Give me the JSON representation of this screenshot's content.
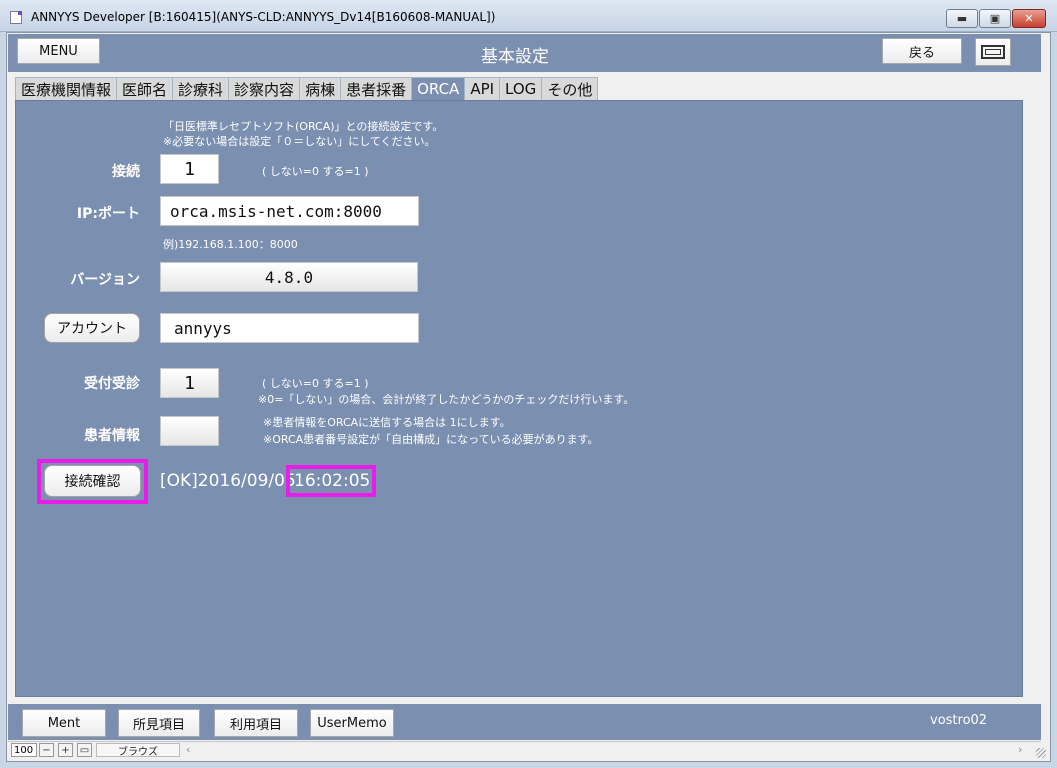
{
  "window": {
    "title": "ANNYYS Developer [B:160415](ANYS-CLD:ANNYYS_Dv14[B160608-MANUAL])",
    "controls": {
      "minimize": "▬",
      "maximize": "▣",
      "close": "✕"
    }
  },
  "header": {
    "menu_label": "MENU",
    "title": "基本設定",
    "back_label": "戻る"
  },
  "tabs": [
    {
      "label": "医療機関情報",
      "active": false
    },
    {
      "label": "医師名",
      "active": false
    },
    {
      "label": "診療科",
      "active": false
    },
    {
      "label": "診察内容",
      "active": false
    },
    {
      "label": "病棟",
      "active": false
    },
    {
      "label": "患者採番",
      "active": false
    },
    {
      "label": "ORCA",
      "active": true
    },
    {
      "label": "API",
      "active": false
    },
    {
      "label": "LOG",
      "active": false
    },
    {
      "label": "その他",
      "active": false
    }
  ],
  "orca": {
    "intro_line1": "「日医標準レセプトソフト(ORCA)」との接続設定です。",
    "intro_line2": "※必要ない場合は設定「０＝しない」にしてください。",
    "connect": {
      "label": "接続",
      "value": "1",
      "hint": "( しない=0 する=1 )"
    },
    "ip_port": {
      "label": "IP:ポート",
      "value": "orca.msis-net.com:8000",
      "example": "例)192.168.1.100：8000"
    },
    "version": {
      "label": "バージョン",
      "value": "4.8.0"
    },
    "account": {
      "button_label": "アカウント",
      "value": "annyys"
    },
    "reception": {
      "label": "受付受診",
      "value": "1",
      "hint": "( しない=0 する=1 )",
      "note": "※0=「しない」の場合、会計が終了したかどうかのチェックだけ行います。"
    },
    "patient_info": {
      "label": "患者情報",
      "value": "",
      "note_line1": "※患者情報をORCAに送信する場合は 1にします。",
      "note_line2": "※ORCA患者番号設定が「自由構成」になっている必要があります。"
    },
    "check": {
      "button_label": "接続確認",
      "status_prefix": "[OK]2016/09/05",
      "status_time": "16:02:05"
    },
    "highlight_color": "#e81ee8"
  },
  "footer": {
    "buttons": [
      "Ment",
      "所見項目",
      "利用項目",
      "UserMemo"
    ],
    "user": "vostro02"
  },
  "statusbar": {
    "zoom": "100",
    "mode": "ブラウズ"
  }
}
